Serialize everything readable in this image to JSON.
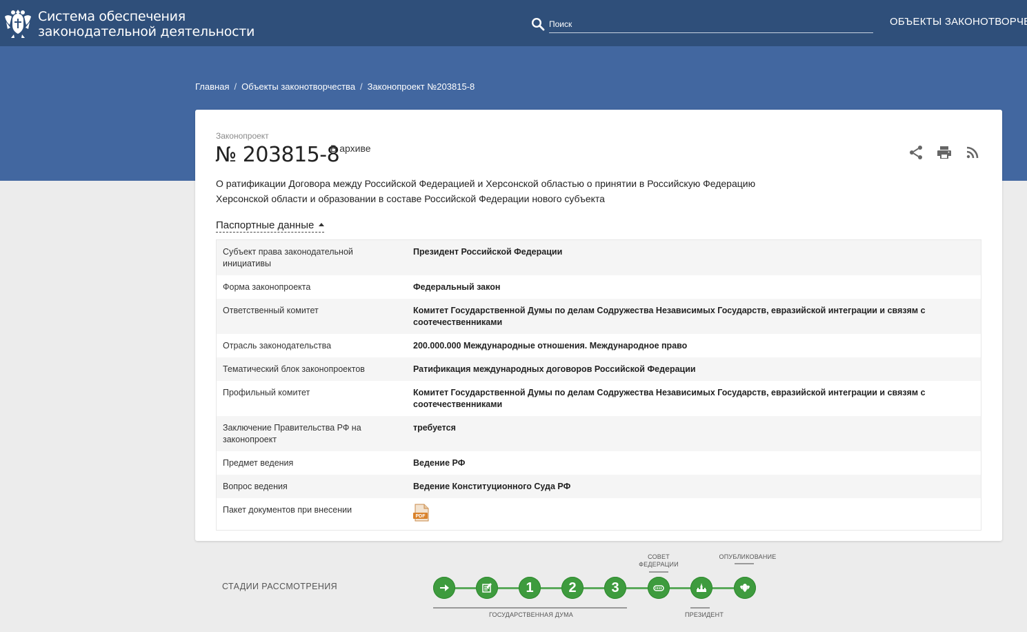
{
  "header": {
    "title_line1": "Система обеспечения",
    "title_line2": "законодательной деятельности",
    "search_placeholder": "Поиск",
    "nav_objects": "ОБЪЕКТЫ ЗАКОНОТВОРЧЕС"
  },
  "breadcrumb": {
    "items": [
      "Главная",
      "Объекты законотворчества",
      "Законопроект №203815-8"
    ],
    "separator": "/"
  },
  "bill": {
    "kind": "Законопроект",
    "number": "№ 203815-8",
    "status": "В архиве",
    "description_line1": "О ратификации Договора между Российской Федерацией и Херсонской областью о принятии в Российскую Федерацию",
    "description_line2": "Херсонской области и образовании в составе Российской Федерации нового субъекта",
    "tools": [
      "share-icon",
      "print-icon",
      "rss-icon"
    ]
  },
  "passport": {
    "toggle_label": "Паспортные данные",
    "rows": [
      {
        "label": "Субъект права законодательной инициативы",
        "value": "Президент Российской Федерации"
      },
      {
        "label": "Форма законопроекта",
        "value": "Федеральный закон"
      },
      {
        "label": "Ответственный комитет",
        "value": "Комитет Государственной Думы по делам Содружества Независимых Государств, евразийской интеграции и связям с соотечественниками"
      },
      {
        "label": "Отрасль законодательства",
        "value": "200.000.000 Международные отношения. Международное право"
      },
      {
        "label": "Тематический блок законопроектов",
        "value": "Ратификация международных договоров Российской Федерации"
      },
      {
        "label": "Профильный комитет",
        "value": "Комитет Государственной Думы по делам Содружества Независимых Государств, евразийской интеграции и связям с соотечественниками"
      },
      {
        "label": "Заключение Правительства РФ на законопроект",
        "value": "требуется"
      },
      {
        "label": "Предмет ведения",
        "value": "Ведение РФ"
      },
      {
        "label": "Вопрос ведения",
        "value": "Ведение Конституционного Суда РФ"
      },
      {
        "label": "Пакет документов при внесении",
        "value": "pdf-icon"
      }
    ]
  },
  "stages": {
    "title": "СТАДИИ РАССМОТРЕНИЯ",
    "steps": [
      {
        "icon": "arrow-right-icon",
        "label": ""
      },
      {
        "icon": "document-icon",
        "label": ""
      },
      {
        "icon": "",
        "label": "1"
      },
      {
        "icon": "",
        "label": "2"
      },
      {
        "icon": "",
        "label": "3"
      },
      {
        "icon": "federation-council-icon",
        "label": ""
      },
      {
        "icon": "kremlin-icon",
        "label": ""
      },
      {
        "icon": "emblem-icon",
        "label": ""
      }
    ],
    "caption_duma": "ГОСУДАРСТВЕННАЯ ДУМА",
    "caption_council_line1": "СОВЕТ",
    "caption_council_line2": "ФЕДЕРАЦИИ",
    "caption_president": "ПРЕЗИДЕНТ",
    "caption_published": "ОПУБЛИКОВАНИЕ"
  },
  "colors": {
    "header_bg": "#2f4f7a",
    "band_bg": "#4267a0",
    "stage_green": "#3e9b3e"
  }
}
